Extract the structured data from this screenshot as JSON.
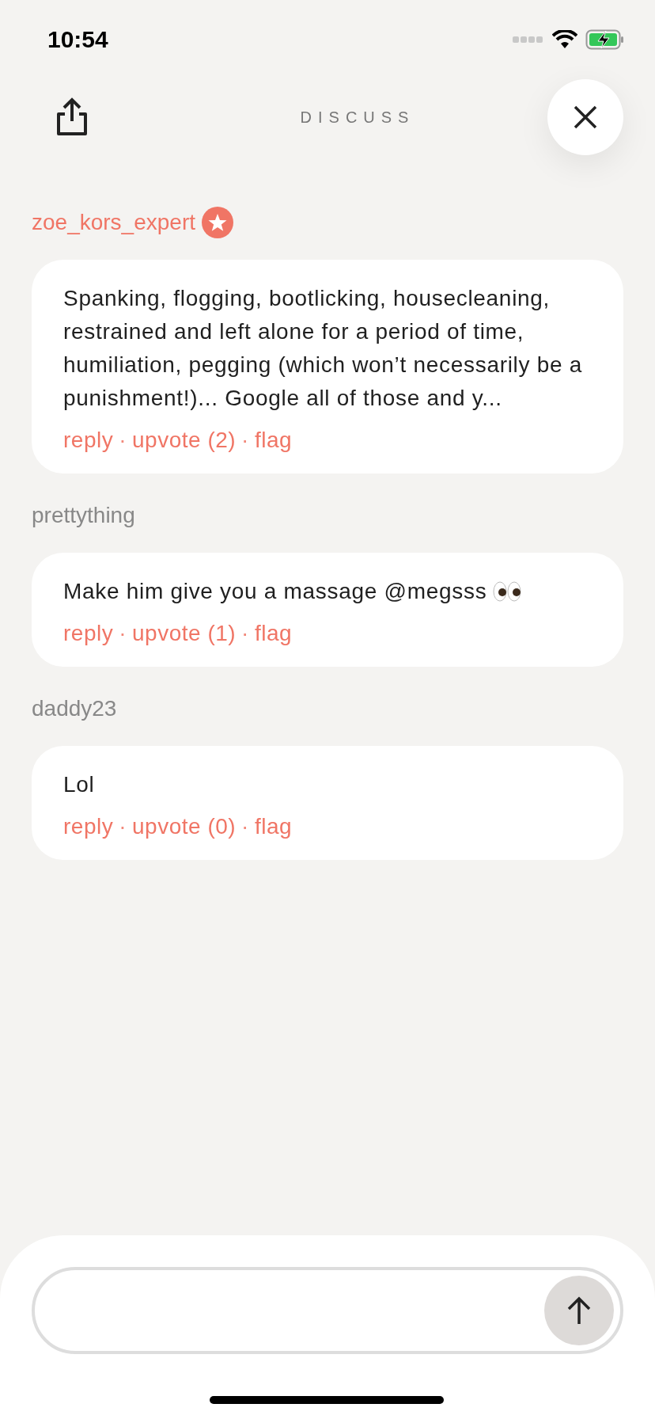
{
  "status_bar": {
    "time": "10:54"
  },
  "header": {
    "title": "DISCUSS"
  },
  "comments": [
    {
      "author": "zoe_kors_expert",
      "highlighted": true,
      "badge": true,
      "text": "Spanking, flogging, bootlicking, housecleaning, restrained and left alone for a period of time, humiliation, pegging (which won’t necessarily be a punishment!)... Google all of those and y...",
      "eyes_emoji": false,
      "actions": [
        {
          "kind": "link",
          "text": "reply"
        },
        {
          "kind": "separator",
          "text": "·"
        },
        {
          "kind": "link",
          "text": "upvote (2)"
        },
        {
          "kind": "separator",
          "text": "·"
        },
        {
          "kind": "link",
          "text": "flag"
        }
      ]
    },
    {
      "author": "prettything",
      "highlighted": false,
      "badge": false,
      "text": "Make him give you a massage @megsss",
      "eyes_emoji": true,
      "actions": [
        {
          "kind": "link",
          "text": "reply"
        },
        {
          "kind": "separator",
          "text": "·"
        },
        {
          "kind": "link",
          "text": "upvote (1)"
        },
        {
          "kind": "separator",
          "text": "·"
        },
        {
          "kind": "link",
          "text": "flag"
        }
      ]
    },
    {
      "author": "daddy23",
      "highlighted": false,
      "badge": false,
      "text": "Lol",
      "eyes_emoji": false,
      "actions": [
        {
          "kind": "link",
          "text": "reply"
        },
        {
          "kind": "separator",
          "text": "·"
        },
        {
          "kind": "link",
          "text": "upvote (0)"
        },
        {
          "kind": "separator",
          "text": "·"
        },
        {
          "kind": "link",
          "text": "flag"
        }
      ]
    }
  ]
}
